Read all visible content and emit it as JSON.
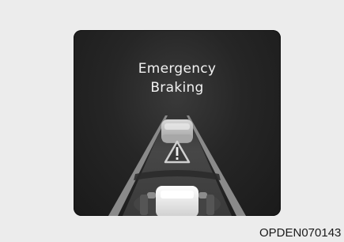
{
  "display": {
    "line1": "Emergency",
    "line2": "Braking"
  },
  "figure_code": "OPDEN070143",
  "icons": [
    "front-vehicle-icon",
    "warning-triangle-icon",
    "own-vehicle-icon"
  ],
  "colors": {
    "panel": "#222222",
    "text": "#f2f2f2",
    "background": "#ececec"
  }
}
